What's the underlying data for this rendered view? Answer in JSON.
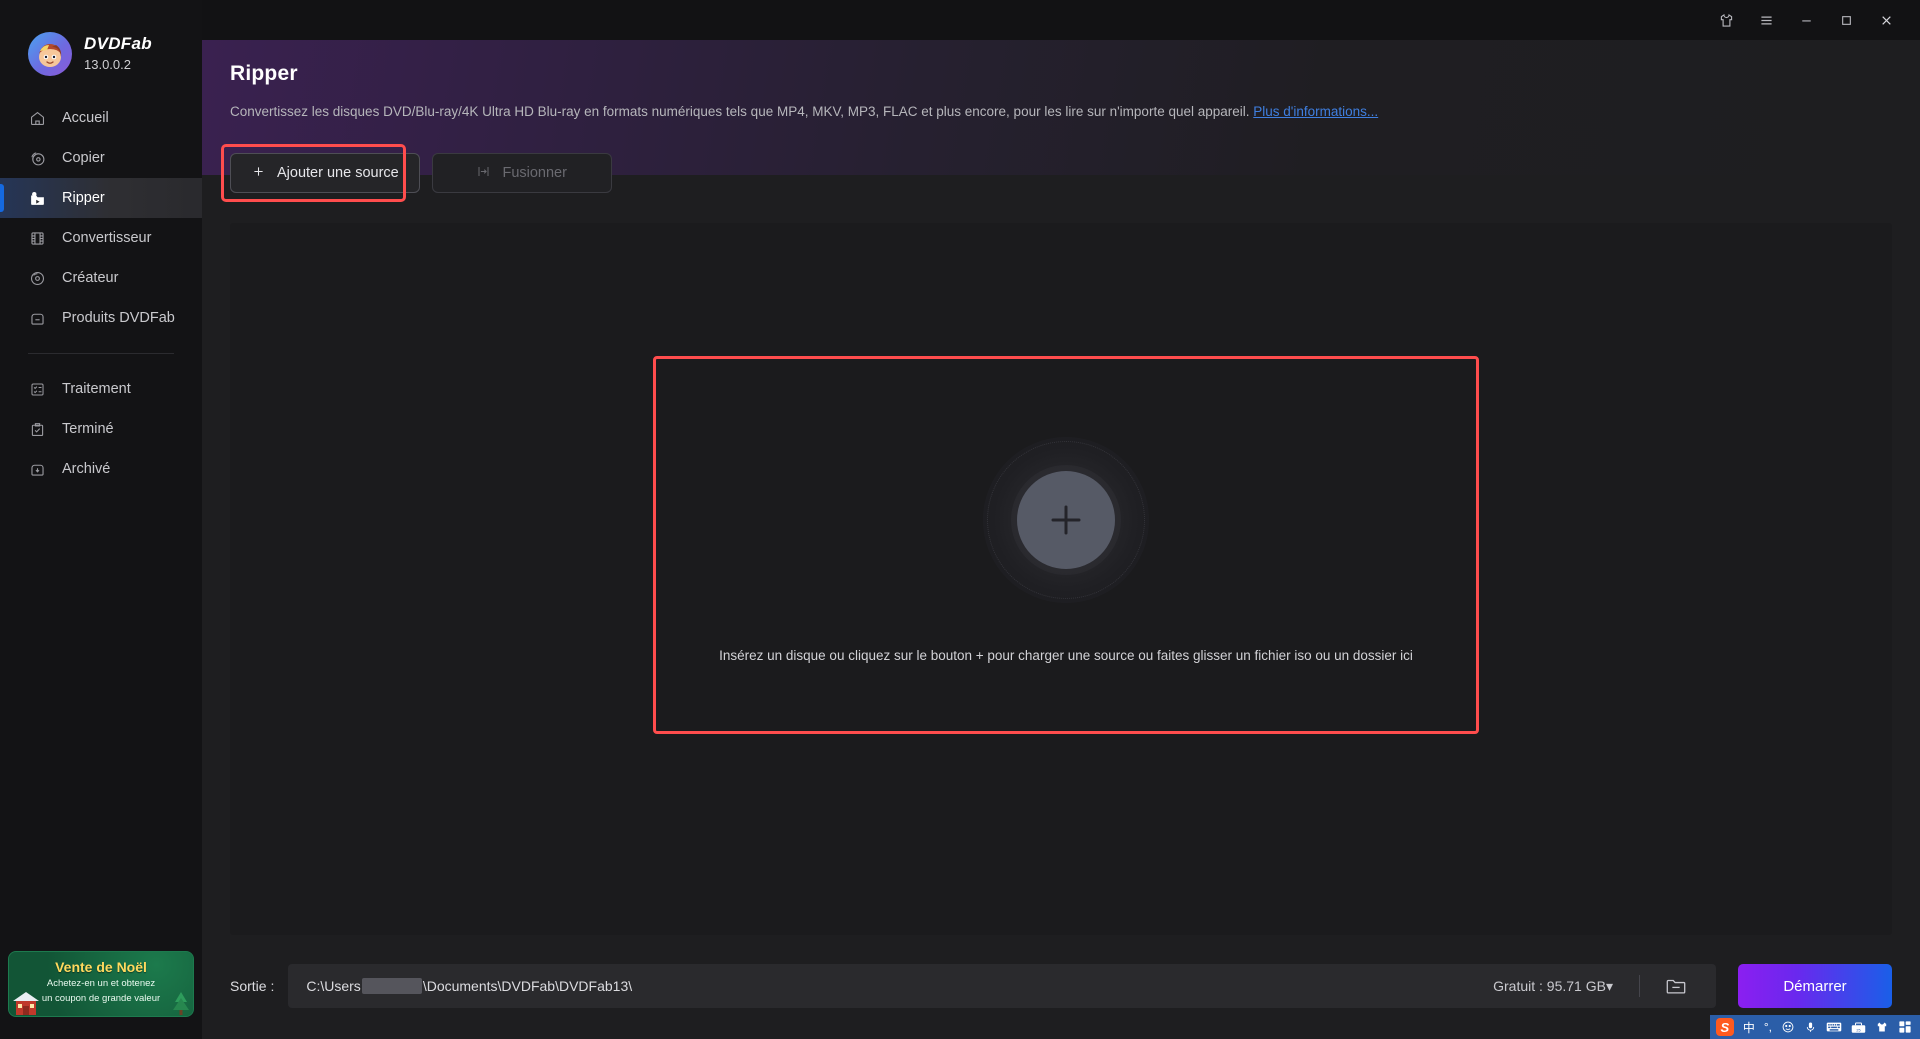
{
  "app": {
    "brand_name": "DVDFab",
    "version": "13.0.0.2"
  },
  "titlebar": {
    "skin_icon": "shirt-icon",
    "menu_icon": "hamburger-menu-icon",
    "minimize_icon": "minimize-icon",
    "maximize_icon": "maximize-icon",
    "close_icon": "close-icon"
  },
  "sidebar": {
    "items": [
      {
        "label": "Accueil",
        "icon": "home-icon",
        "active": false
      },
      {
        "label": "Copier",
        "icon": "copy-disc-icon",
        "active": false
      },
      {
        "label": "Ripper",
        "icon": "ripper-icon",
        "active": true
      },
      {
        "label": "Convertisseur",
        "icon": "film-strip-icon",
        "active": false
      },
      {
        "label": "Créateur",
        "icon": "disc-burn-icon",
        "active": false
      },
      {
        "label": "Produits DVDFab",
        "icon": "box-icon",
        "active": false
      }
    ],
    "items_secondary": [
      {
        "label": "Traitement",
        "icon": "task-list-icon"
      },
      {
        "label": "Terminé",
        "icon": "clipboard-check-icon"
      },
      {
        "label": "Archivé",
        "icon": "archive-icon"
      }
    ],
    "promo": {
      "title": "Vente de Noël",
      "line1": "Achetez-en un et obtenez",
      "line2": "un coupon de grande valeur"
    }
  },
  "hero": {
    "title": "Ripper",
    "description": "Convertissez les disques DVD/Blu-ray/4K Ultra HD Blu-ray en formats numériques tels que MP4, MKV, MP3, FLAC et plus encore, pour les lire sur n'importe quel appareil.",
    "link_label": "Plus d'informations..."
  },
  "toolbar": {
    "add_source_label": "Ajouter une source",
    "add_source_icon": "plus-icon",
    "merge_label": "Fusionner",
    "merge_icon": "merge-icon",
    "merge_disabled": true
  },
  "dropzone": {
    "center_icon": "add-disc-plus-icon",
    "hint": "Insérez un disque ou cliquez sur le bouton +  pour charger une source ou faites glisser un fichier iso ou un dossier ici"
  },
  "bottom": {
    "output_label": "Sortie :",
    "output_path_prefix": "C:\\Users",
    "output_path_suffix": "\\Documents\\DVDFab\\DVDFab13\\",
    "free_space": "Gratuit : 95.71 GB",
    "free_space_caret": "▾",
    "browse_icon": "folder-icon",
    "start_label": "Démarrer"
  },
  "tray": {
    "items": [
      {
        "icon": "sogou-logo-icon",
        "label": "S"
      },
      {
        "icon": "chinese-mode-icon",
        "label": "中"
      },
      {
        "icon": "punctuation-icon",
        "label": "°,"
      },
      {
        "icon": "emoji-icon",
        "label": "☺"
      },
      {
        "icon": "microphone-icon",
        "label": ""
      },
      {
        "icon": "keyboard-icon",
        "label": ""
      },
      {
        "icon": "toolbox-icon",
        "label": ""
      },
      {
        "icon": "skin-shirt-icon",
        "label": ""
      },
      {
        "icon": "app-grid-icon",
        "label": ""
      }
    ]
  },
  "colors": {
    "accent_blue": "#1569e0",
    "highlight_red": "#ff4d4d",
    "link_blue": "#3f7fe0",
    "promo_green": "#16613f",
    "promo_yellow": "#ffd95e"
  }
}
